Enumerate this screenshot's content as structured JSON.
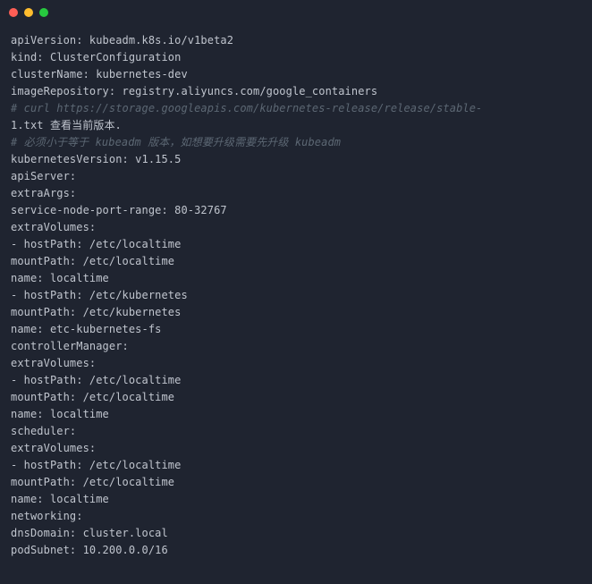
{
  "lines": [
    {
      "t": "plain",
      "v": "apiVersion: kubeadm.k8s.io/v1beta2"
    },
    {
      "t": "plain",
      "v": "kind: ClusterConfiguration"
    },
    {
      "t": "plain",
      "v": "clusterName: kubernetes-dev"
    },
    {
      "t": "plain",
      "v": "imageRepository: registry.aliyuncs.com/google_containers"
    },
    {
      "t": "comment",
      "v": "# curl https://storage.googleapis.com/kubernetes-release/release/stable-"
    },
    {
      "t": "mixed",
      "a": "1.txt ",
      "b": "查看当前版本."
    },
    {
      "t": "comment-mixed",
      "a": "# ",
      "b": "必须小于等于",
      "c": " kubeadm ",
      "d": "版本，如想要升级需要先升级",
      "e": " kubeadm"
    },
    {
      "t": "plain",
      "v": "kubernetesVersion: v1.15.5"
    },
    {
      "t": "plain",
      "v": "apiServer:"
    },
    {
      "t": "plain",
      "v": "extraArgs:"
    },
    {
      "t": "plain",
      "v": "service-node-port-range: 80-32767"
    },
    {
      "t": "plain",
      "v": "extraVolumes:"
    },
    {
      "t": "plain",
      "v": "- hostPath: /etc/localtime"
    },
    {
      "t": "plain",
      "v": "mountPath: /etc/localtime"
    },
    {
      "t": "plain",
      "v": "name: localtime"
    },
    {
      "t": "plain",
      "v": "- hostPath: /etc/kubernetes"
    },
    {
      "t": "plain",
      "v": "mountPath: /etc/kubernetes"
    },
    {
      "t": "plain",
      "v": "name: etc-kubernetes-fs"
    },
    {
      "t": "plain",
      "v": "controllerManager:"
    },
    {
      "t": "plain",
      "v": "extraVolumes:"
    },
    {
      "t": "plain",
      "v": "- hostPath: /etc/localtime"
    },
    {
      "t": "plain",
      "v": "mountPath: /etc/localtime"
    },
    {
      "t": "plain",
      "v": "name: localtime"
    },
    {
      "t": "plain",
      "v": "scheduler:"
    },
    {
      "t": "plain",
      "v": "extraVolumes:"
    },
    {
      "t": "plain",
      "v": "- hostPath: /etc/localtime"
    },
    {
      "t": "plain",
      "v": "mountPath: /etc/localtime"
    },
    {
      "t": "plain",
      "v": "name: localtime"
    },
    {
      "t": "plain",
      "v": "networking:"
    },
    {
      "t": "plain",
      "v": "dnsDomain: cluster.local"
    },
    {
      "t": "plain",
      "v": "podSubnet: 10.200.0.0/16"
    }
  ]
}
